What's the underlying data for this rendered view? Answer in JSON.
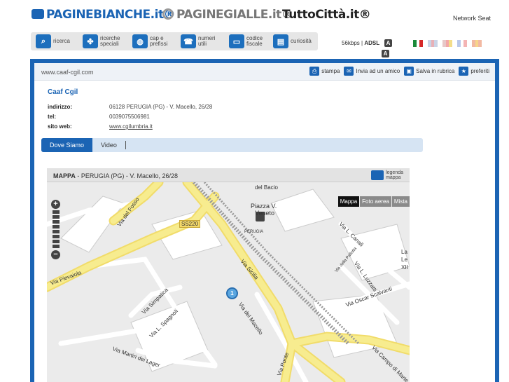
{
  "brands": {
    "paginebianche": "PAGINEBIANCHE.it®",
    "paginegialle": "PAGINEGIALLE.it®",
    "tuttocitta": "TuttoCittà.it®"
  },
  "network": "Network Seat",
  "nav": [
    {
      "label": "ricerca",
      "icon": "search-icon"
    },
    {
      "label": "ricerche\nspeciali",
      "icon": "clover-icon"
    },
    {
      "label": "cap e\nprefissi",
      "icon": "globe-icon"
    },
    {
      "label": "numeri\nutili",
      "icon": "phone-icon"
    },
    {
      "label": "codice\nfiscale",
      "icon": "card-icon"
    },
    {
      "label": "curiosità",
      "icon": "info-icon"
    }
  ],
  "connection": {
    "speed": "56kbps",
    "type": "ADSL",
    "badge": "A"
  },
  "flags": [
    {
      "name": "it-flag",
      "colors": [
        "#1b8a3a",
        "#ffffff",
        "#d62828"
      ]
    },
    {
      "name": "en-flag",
      "colors": [
        "#c9d3e6",
        "#e8b0b6",
        "#c9d3e6"
      ]
    },
    {
      "name": "de-flag",
      "colors": [
        "#e7c8c8",
        "#f3a7a7",
        "#f3dd8a"
      ]
    },
    {
      "name": "fr-flag",
      "colors": [
        "#b8c7ea",
        "#ffffff",
        "#f4b4b4"
      ]
    },
    {
      "name": "es-flag",
      "colors": [
        "#f2b9a3",
        "#f7d58a",
        "#f2b9a3"
      ]
    }
  ],
  "urlbar": {
    "url": "www.caaf-cgil.com",
    "actions": [
      {
        "label": "stampa",
        "icon": "printer-icon"
      },
      {
        "label": "Invia ad un amico",
        "icon": "mail-icon"
      },
      {
        "label": "Salva in rubrica",
        "icon": "save-icon"
      },
      {
        "label": "preferiti",
        "icon": "star-icon"
      }
    ]
  },
  "listing": {
    "title": "Caaf Cgil",
    "fields": [
      {
        "key": "indirizzo:",
        "value": "06128 PERUGIA (PG) - V. Macello, 26/28"
      },
      {
        "key": "tel:",
        "value": "0039075506981"
      },
      {
        "key": "sito web:",
        "value": "www.cgilumbria.it"
      }
    ]
  },
  "tabs": {
    "active": "Dove Siamo",
    "other": "Video"
  },
  "map": {
    "heading": "MAPPA",
    "address": "PERUGIA (PG) - V. Macello, 26/28",
    "legend": "legenda\nmappa",
    "modes": [
      "Mappa",
      "Foto aerea",
      "Mista"
    ],
    "pin": "1",
    "shield": "SS220",
    "places": [
      {
        "text": "del Bacio"
      },
      {
        "text": "Piazza V."
      },
      {
        "text": "Veneto"
      },
      {
        "text": "PERUGIA"
      },
      {
        "text": "Via del Fosso"
      },
      {
        "text": "Via Pievaiola"
      },
      {
        "text": "Via Sicilia"
      },
      {
        "text": "Via Simpatica"
      },
      {
        "text": "Via L. Spagnoli"
      },
      {
        "text": "Via del Macello"
      },
      {
        "text": "Via Martiri dei Lager"
      },
      {
        "text": "Via L. Canali"
      },
      {
        "text": "Via della Pallotta"
      },
      {
        "text": "Via L. Luzzatti"
      },
      {
        "text": "Via Oscar Scalvanti"
      },
      {
        "text": "Via Campo di Marte"
      },
      {
        "text": "Via Ponte"
      },
      {
        "text": "La"
      },
      {
        "text": "Le"
      },
      {
        "text": "XII"
      }
    ]
  },
  "colors": {
    "brand": "#1b64b4",
    "road": "#f7ec8f",
    "map_bg": "#ebebeb"
  }
}
